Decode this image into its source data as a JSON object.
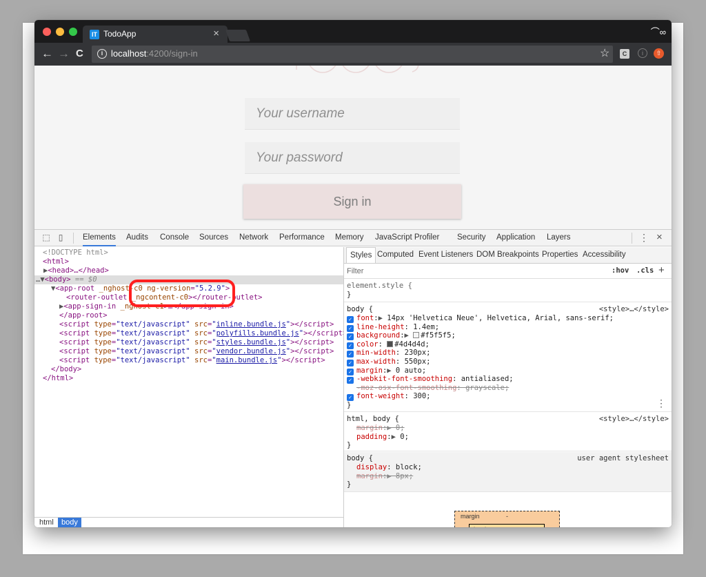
{
  "browser": {
    "tab_title": "TodoApp",
    "tab_favicon_text": "IT",
    "tab_close": "×",
    "url_host": "localhost",
    "url_path": ":4200/sign-in",
    "info_icon": "i",
    "nav_back": "←",
    "nav_forward": "→",
    "nav_reload": "C",
    "star": "☆",
    "ext1": "C",
    "ext2": "i",
    "ext3": "⇧",
    "incognito": "⌒∞"
  },
  "page": {
    "username_placeholder": "Your username",
    "password_placeholder": "Your password",
    "signin_label": "Sign in"
  },
  "devtools": {
    "inspect_icon": "⬚",
    "device_icon": "▯",
    "tabs": [
      "Elements",
      "Audits",
      "Console",
      "Sources",
      "Network",
      "Performance",
      "Memory",
      "JavaScript Profiler",
      "Security",
      "Application",
      "Layers"
    ],
    "more": "⋮",
    "close": "×",
    "dom": {
      "doctype": "<!DOCTYPE html>",
      "html_open": "<html>",
      "head": "<head>…</head>",
      "body_prefix": "…",
      "body_open": "<body>",
      "body_eq": " == $0",
      "app_root_attr1": "_nghost-c0",
      "app_root_attr2": "ng-version",
      "app_root_val": "\"5.2.9\"",
      "router_outlet_attr": "_ngcontent-c0",
      "app_sign_in_attr": "_nghost-c1",
      "scripts": [
        {
          "src": "inline.bundle.js"
        },
        {
          "src": "polyfills.bundle.js"
        },
        {
          "src": "styles.bundle.js"
        },
        {
          "src": "vendor.bundle.js"
        },
        {
          "src": "main.bundle.js"
        }
      ],
      "script_type": "\"text/javascript\""
    },
    "breadcrumbs": [
      "html",
      "body"
    ],
    "styles_tabs": [
      "Styles",
      "Computed",
      "Event Listeners",
      "DOM Breakpoints",
      "Properties",
      "Accessibility"
    ],
    "filter_placeholder": "Filter",
    "hov": ":hov",
    "cls": ".cls",
    "plus": "+",
    "element_style": "element.style {",
    "close_brace": "}",
    "style_source": "<style>…</style>",
    "ua_source": "user agent stylesheet",
    "body_rule": {
      "selector": "body {",
      "props": [
        {
          "name": "font",
          "value": "14px 'Helvetica Neue', Helvetica, Arial, sans-serif;",
          "arrow": true,
          "checked": true
        },
        {
          "name": "line-height",
          "value": "1.4em;",
          "checked": true
        },
        {
          "name": "background",
          "value": "#f5f5f5;",
          "arrow": true,
          "swatch": "#f5f5f5",
          "checked": true
        },
        {
          "name": "color",
          "value": "#4d4d4d;",
          "swatch": "#4d4d4d",
          "checked": true
        },
        {
          "name": "min-width",
          "value": "230px;",
          "checked": true
        },
        {
          "name": "max-width",
          "value": "550px;",
          "checked": true
        },
        {
          "name": "margin",
          "value": "0 auto;",
          "arrow": true,
          "checked": true
        },
        {
          "name": "-webkit-font-smoothing",
          "value": "antialiased;",
          "checked": true
        },
        {
          "name": "-moz-osx-font-smoothing",
          "value": "grayscale;",
          "strike": true
        },
        {
          "name": "font-weight",
          "value": "300;",
          "checked": true
        }
      ]
    },
    "html_body_rule": {
      "selector": "html, body {",
      "props": [
        {
          "name": "margin",
          "value": "0;",
          "arrow": true,
          "strike": true
        },
        {
          "name": "padding",
          "value": "0;",
          "arrow": true
        }
      ]
    },
    "ua_body_rule": {
      "selector": "body {",
      "props": [
        {
          "name": "display",
          "value": "block;"
        },
        {
          "name": "margin",
          "value": "8px;",
          "arrow": true,
          "strike": true
        }
      ]
    },
    "box_margin_label": "margin",
    "box_margin_value": "-",
    "box_border_label": "border"
  },
  "colors": {
    "accent_blue": "#3879d9",
    "annotation_red": "#ff1f1f",
    "tag_purple": "#881280",
    "attr_brown": "#994500",
    "value_blue": "#1a1aa6"
  }
}
